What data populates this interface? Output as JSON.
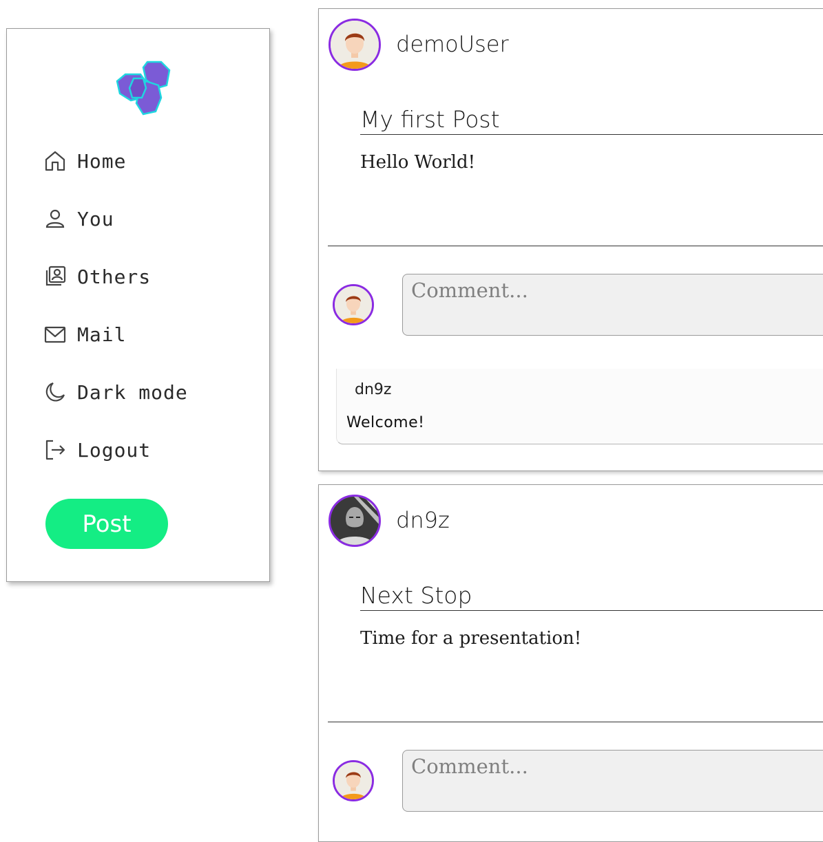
{
  "sidebar": {
    "logo_icon": "hexagon-cluster-logo",
    "items": [
      {
        "label": "Home",
        "icon": "home-icon"
      },
      {
        "label": "You",
        "icon": "user-icon"
      },
      {
        "label": "Others",
        "icon": "contacts-icon"
      },
      {
        "label": "Mail",
        "icon": "mail-icon"
      },
      {
        "label": "Dark mode",
        "icon": "moon-icon"
      },
      {
        "label": "Logout",
        "icon": "logout-icon"
      }
    ],
    "post_button": "Post"
  },
  "posts": [
    {
      "author": "demoUser",
      "title": "My first Post",
      "body": "Hello World!",
      "comment_placeholder": "Comment...",
      "comments": [
        {
          "author": "dn9z",
          "text": "Welcome!"
        }
      ]
    },
    {
      "author": "dn9z",
      "title": "Next Stop",
      "body": "Time for a presentation!",
      "comment_placeholder": "Comment..."
    }
  ],
  "colors": {
    "accent_green": "#14ed84",
    "avatar_border": "#8a2be2",
    "logo_purple": "#7b5bd6",
    "logo_outline": "#1fd6e0"
  }
}
